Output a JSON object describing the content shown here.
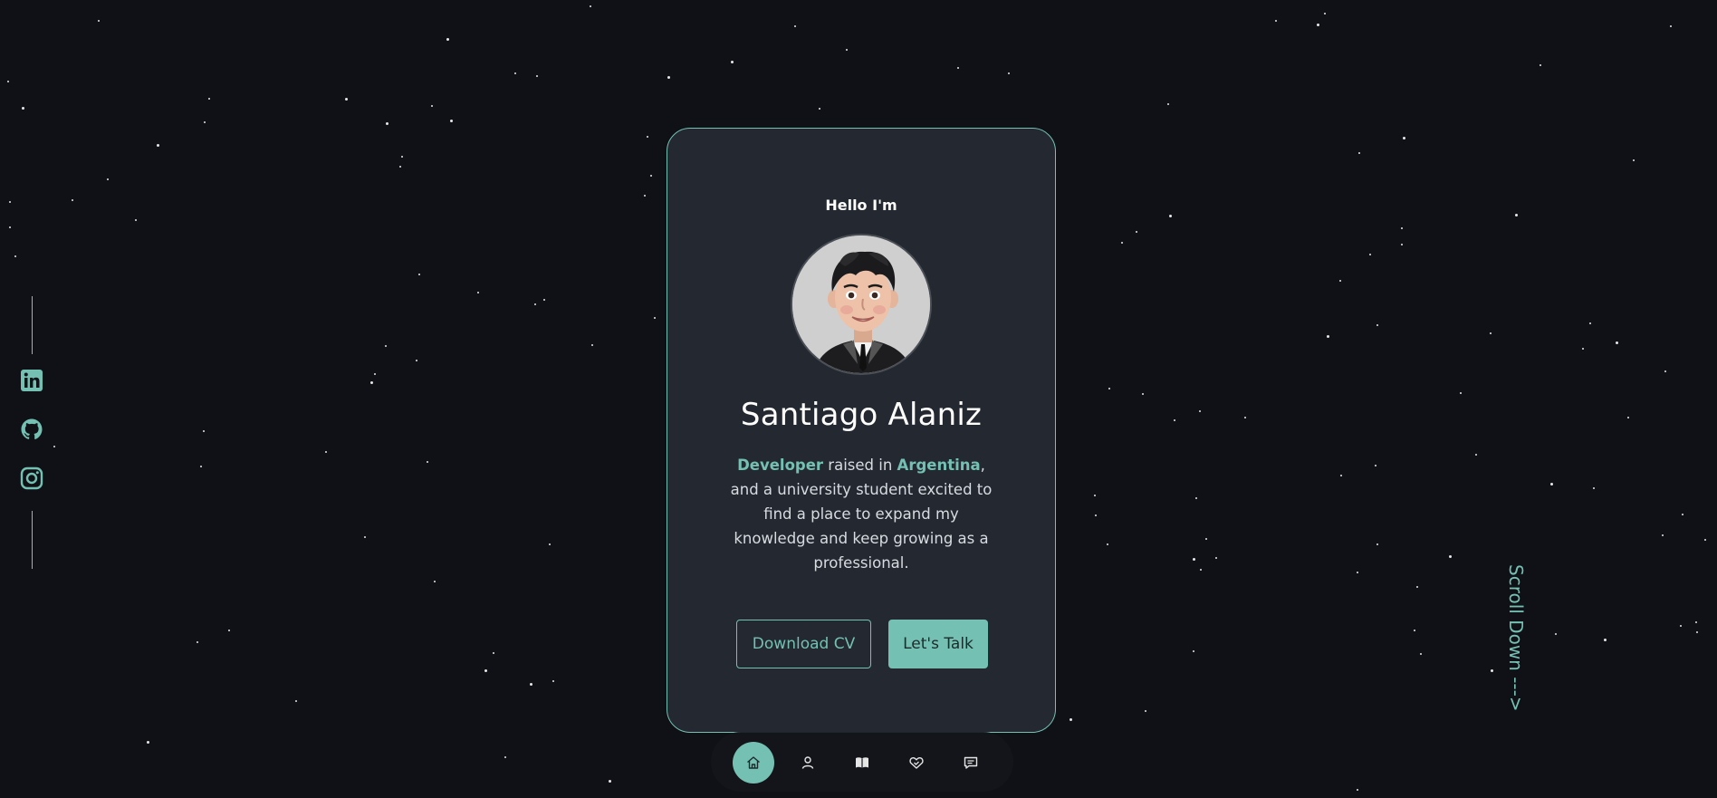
{
  "hero": {
    "greeting": "Hello I'm",
    "name": "Santiago Alaniz",
    "bio": {
      "highlight_role": "Developer",
      "text_1": " raised in ",
      "highlight_place": "Argentina",
      "text_2": ", and a university student excited to find a place to expand my knowledge and keep growing as a professional."
    },
    "avatar_alt": "avatar"
  },
  "buttons": {
    "download": "Download CV",
    "talk": "Let's Talk"
  },
  "socials": [
    {
      "name": "linkedin",
      "icon": "linkedin-icon"
    },
    {
      "name": "github",
      "icon": "github-icon"
    },
    {
      "name": "instagram",
      "icon": "instagram-icon"
    }
  ],
  "nav": [
    {
      "icon": "home-icon",
      "active": true
    },
    {
      "icon": "user-icon",
      "active": false
    },
    {
      "icon": "book-icon",
      "active": false
    },
    {
      "icon": "handshake-icon",
      "active": false
    },
    {
      "icon": "message-icon",
      "active": false
    }
  ],
  "scroll_label": "Scroll Down --->",
  "colors": {
    "accent": "#74c1b3",
    "background": "#0f1116",
    "card": "#232831"
  }
}
